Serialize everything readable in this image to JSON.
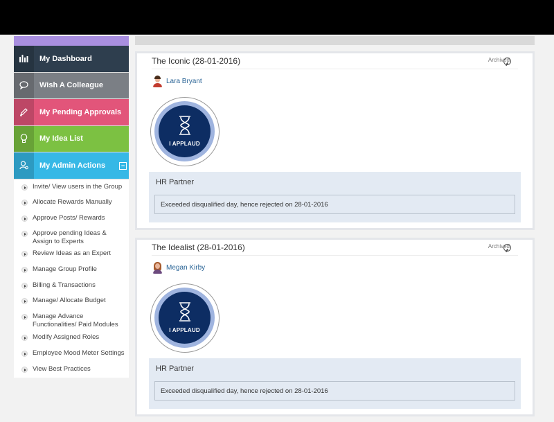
{
  "sidebar": {
    "items": [
      {
        "label": "My Dashboard",
        "icon": "bar-chart-icon"
      },
      {
        "label": "Wish A Colleague",
        "icon": "speech-bubble-icon"
      },
      {
        "label": "My Pending Approvals",
        "icon": "pen-icon"
      },
      {
        "label": "My Idea List",
        "icon": "lightbulb-icon"
      },
      {
        "label": "My Admin Actions",
        "icon": "admin-user-icon"
      }
    ],
    "admin_collapse": "−",
    "sub_items": [
      "Invite/ View users in the Group",
      "Allocate Rewards Manually",
      "Approve Posts/ Rewards",
      "Approve pending Ideas & Assign to Experts",
      "Review Ideas as an Expert",
      "Manage Group Profile",
      "Billing & Transactions",
      "Manage/ Allocate Budget",
      "Manage Advance Functionalities/ Paid Modules",
      "Modify Assigned Roles",
      "Employee Mood Meter Settings",
      "View Best Practices"
    ]
  },
  "cards": [
    {
      "title": "The Iconic (28-01-2016)",
      "archived": "Archived",
      "user": "Lara Bryant",
      "badge": "I APPLAUD",
      "feedback_label": "HR Partner",
      "feedback_text": "Exceeded disqualified day, hence rejected on 28-01-2016"
    },
    {
      "title": "The Idealist (28-01-2016)",
      "archived": "Archived",
      "user": "Megan Kirby",
      "badge": "I APPLAUD",
      "feedback_label": "HR Partner",
      "feedback_text": "Exceeded disqualified day, hence rejected on 28-01-2016"
    }
  ],
  "colors": {
    "dashboard": "#2e3e4e",
    "colleague": "#7b7f85",
    "approvals": "#e2557a",
    "idea": "#7cc142",
    "admin": "#36b8e6",
    "badge": "#0d2d63"
  }
}
